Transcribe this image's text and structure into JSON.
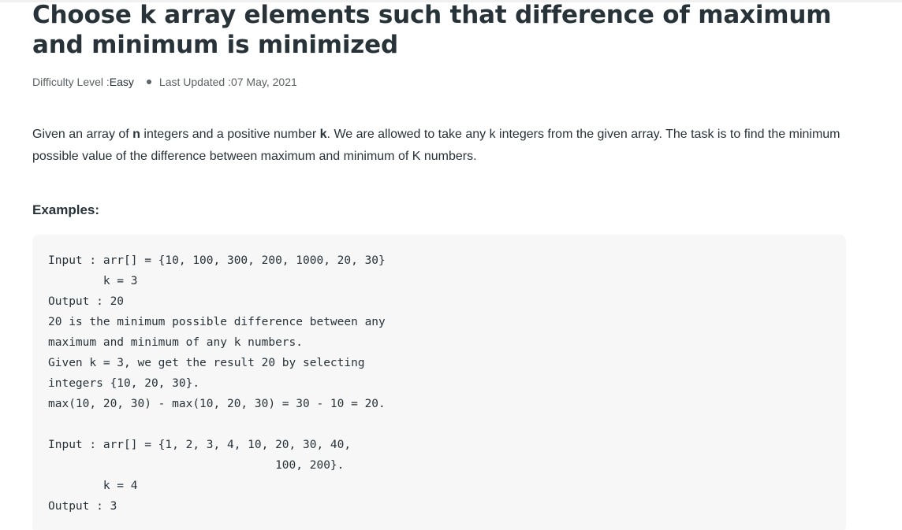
{
  "article": {
    "title": "Choose k array elements such that difference of maximum and minimum is minimized",
    "meta": {
      "difficulty_label": "Difficulty Level : ",
      "difficulty_value": "Easy",
      "updated_label": "Last Updated : ",
      "updated_value": "07 May, 2021"
    },
    "description": {
      "part1": "Given an array of ",
      "n": "n",
      "part2": " integers and a positive number ",
      "k": "k",
      "part3": ". We are allowed to take any k integers from the given array. The task is to find the minimum possible value of the difference between maximum and minimum of K numbers."
    },
    "examples_heading": "Examples:",
    "code_lines": [
      "Input : arr[] = {10, 100, 300, 200, 1000, 20, 30}",
      "        k = 3",
      "Output : 20",
      "20 is the minimum possible difference between any",
      "maximum and minimum of any k numbers.",
      "Given k = 3, we get the result 20 by selecting",
      "integers {10, 20, 30}.",
      "max(10, 20, 30) - max(10, 20, 30) = 30 - 10 = 20.",
      "",
      "Input : arr[] = {1, 2, 3, 4, 10, 20, 30, 40,",
      "                                 100, 200}.",
      "        k = 4",
      "Output : 3"
    ]
  }
}
